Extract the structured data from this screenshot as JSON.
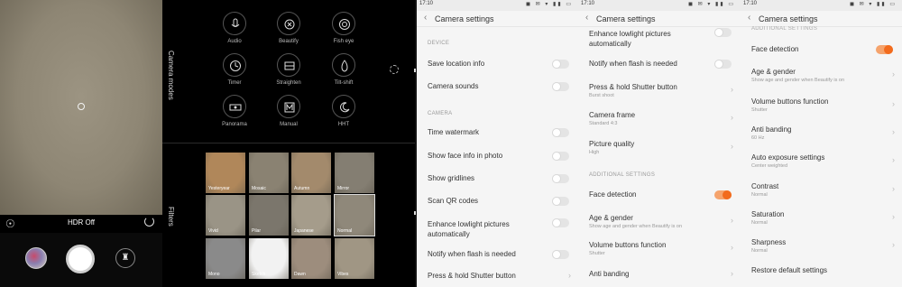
{
  "viewfinder": {
    "hdr_label": "HDR Off"
  },
  "camera_modes": {
    "section_label": "Camera modes",
    "items": [
      {
        "label": "Audio",
        "icon": "microphone-icon"
      },
      {
        "label": "Beautify",
        "icon": "beautify-icon"
      },
      {
        "label": "Fish eye",
        "icon": "fish-eye-icon"
      },
      {
        "label": "Timer",
        "icon": "timer-icon"
      },
      {
        "label": "Straighten",
        "icon": "straighten-icon"
      },
      {
        "label": "Tilt-shift",
        "icon": "tilt-shift-icon"
      },
      {
        "label": "Panorama",
        "icon": "panorama-icon"
      },
      {
        "label": "Manual",
        "icon": "manual-icon"
      },
      {
        "label": "HHT",
        "icon": "hht-icon"
      }
    ]
  },
  "filters": {
    "section_label": "Filters",
    "items": [
      {
        "label": "Yesteryear",
        "color": "#b0875a"
      },
      {
        "label": "Mosaic",
        "color": "#8a8272"
      },
      {
        "label": "Autumn",
        "color": "#a38a6c"
      },
      {
        "label": "Mirror",
        "color": "#847e72"
      },
      {
        "label": "Vivid",
        "color": "#9a9486"
      },
      {
        "label": "Pilar",
        "color": "#7b766c"
      },
      {
        "label": "Japanese",
        "color": "#a59c8b"
      },
      {
        "label": "Normal",
        "color": "#8f887a"
      },
      {
        "label": "Mono",
        "color": "#8a8a8a"
      },
      {
        "label": "Sketch",
        "color": "#f2f2f2"
      },
      {
        "label": "Dawn",
        "color": "#9d8d7d"
      },
      {
        "label": "Vibes",
        "color": "#a09684"
      }
    ]
  },
  "status_time": "17:10",
  "settings_title": "Camera settings",
  "panel_a": {
    "sections": {
      "device": "DEVICE",
      "camera": "CAMERA"
    },
    "rows": [
      {
        "label": "Save location info",
        "control": "toggle",
        "on": false
      },
      {
        "label": "Camera sounds",
        "control": "toggle",
        "on": false
      },
      {
        "label": "Time watermark",
        "control": "toggle",
        "on": false
      },
      {
        "label": "Show face info in photo",
        "control": "toggle",
        "on": false
      },
      {
        "label": "Show gridlines",
        "control": "toggle",
        "on": false
      },
      {
        "label": "Scan QR codes",
        "control": "toggle",
        "on": false
      },
      {
        "label": "Enhance lowlight pictures",
        "label2": "automatically",
        "control": "toggle",
        "on": false
      },
      {
        "label": "Notify when flash is needed",
        "control": "toggle",
        "on": false
      },
      {
        "label": "Press & hold Shutter button",
        "control": "chevron"
      }
    ]
  },
  "panel_b": {
    "sections": {
      "additional": "ADDITIONAL SETTINGS"
    },
    "rows": [
      {
        "label": "Enhance lowlight pictures",
        "label2": "automatically",
        "control": "toggle",
        "on": false
      },
      {
        "label": "Notify when flash is needed",
        "control": "toggle",
        "on": false
      },
      {
        "label": "Press & hold Shutter button",
        "sub": "Burst shoot",
        "control": "chevron"
      },
      {
        "label": "Camera frame",
        "sub": "Standard 4:3",
        "control": "chevron"
      },
      {
        "label": "Picture quality",
        "sub": "High",
        "control": "chevron"
      },
      {
        "label": "Face detection",
        "control": "toggle",
        "on": true
      },
      {
        "label": "Age & gender",
        "sub": "Show age and gender when Beautify is on",
        "control": "chevron"
      },
      {
        "label": "Volume buttons function",
        "sub": "Shutter",
        "control": "chevron"
      },
      {
        "label": "Anti banding",
        "control": "chevron"
      }
    ]
  },
  "panel_c": {
    "sections": {
      "additional": "ADDITIONAL SETTINGS"
    },
    "rows": [
      {
        "label": "Face detection",
        "control": "toggle",
        "on": true
      },
      {
        "label": "Age & gender",
        "sub": "Show age and gender when Beautify is on",
        "control": "chevron"
      },
      {
        "label": "Volume buttons function",
        "sub": "Shutter",
        "control": "chevron"
      },
      {
        "label": "Anti banding",
        "sub": "60 Hz",
        "control": "chevron"
      },
      {
        "label": "Auto exposure settings",
        "sub": "Center weighted",
        "control": "chevron"
      },
      {
        "label": "Contrast",
        "sub": "Normal",
        "control": "chevron"
      },
      {
        "label": "Saturation",
        "sub": "Normal",
        "control": "chevron"
      },
      {
        "label": "Sharpness",
        "sub": "Normal",
        "control": "chevron"
      },
      {
        "label": "Restore default settings",
        "control": "none"
      }
    ]
  },
  "colors": {
    "accent": "#f26b1d",
    "panel_bg": "#f5f5f5"
  }
}
